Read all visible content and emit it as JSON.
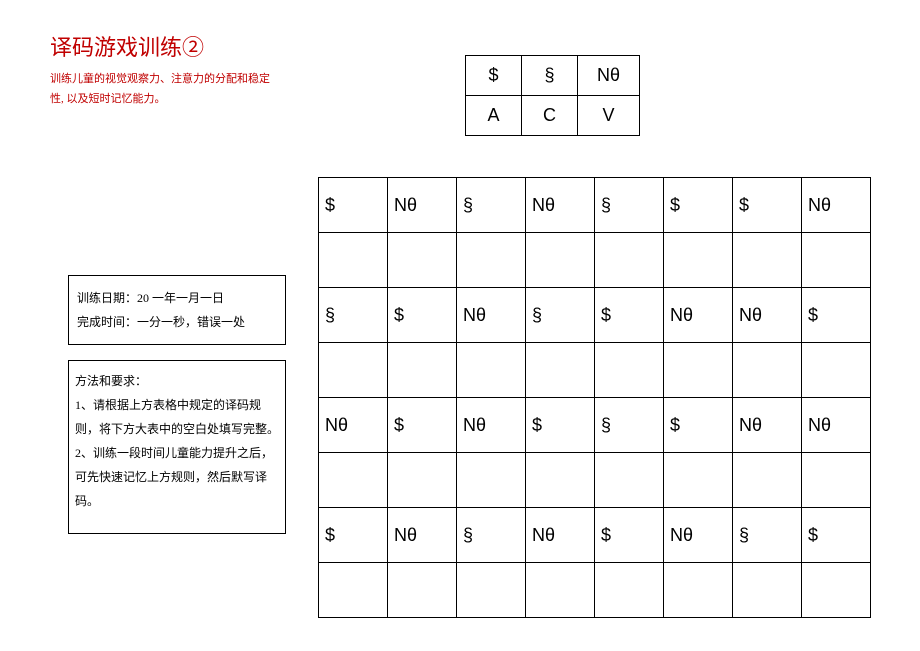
{
  "title": "译码游戏训练②",
  "subtitle": "训练儿童的视觉观察力、注意力的分配和稳定性, 以及短时记忆能力。",
  "key": {
    "row1": [
      "$",
      "§",
      "Nθ"
    ],
    "row2": [
      "A",
      "C",
      "V"
    ]
  },
  "grid": {
    "rows": [
      [
        "$",
        "Nθ",
        "§",
        "Nθ",
        "§",
        "$",
        "$",
        "Nθ"
      ],
      [
        "",
        "",
        "",
        "",
        "",
        "",
        "",
        ""
      ],
      [
        "§",
        "$",
        "Nθ",
        "§",
        "$",
        "Nθ",
        "Nθ",
        "$"
      ],
      [
        "",
        "",
        "",
        "",
        "",
        "",
        "",
        ""
      ],
      [
        "Nθ",
        "$",
        "Nθ",
        "$",
        "§",
        "$",
        "Nθ",
        "Nθ"
      ],
      [
        "",
        "",
        "",
        "",
        "",
        "",
        "",
        ""
      ],
      [
        "$",
        "Nθ",
        "§",
        "Nθ",
        "$",
        "Nθ",
        "§",
        "$"
      ],
      [
        "",
        "",
        "",
        "",
        "",
        "",
        "",
        ""
      ]
    ]
  },
  "info": {
    "line1": "训练日期：20 一年一月一日",
    "line2": "完成时间：一分一秒，错误一处"
  },
  "method": {
    "heading": "方法和要求：",
    "item1": "1、请根据上方表格中规定的译码规则，将下方大表中的空白处填写完整。",
    "item2": "2、训练一段时间儿童能力提升之后，可先快速记忆上方规则，然后默写译码。"
  }
}
